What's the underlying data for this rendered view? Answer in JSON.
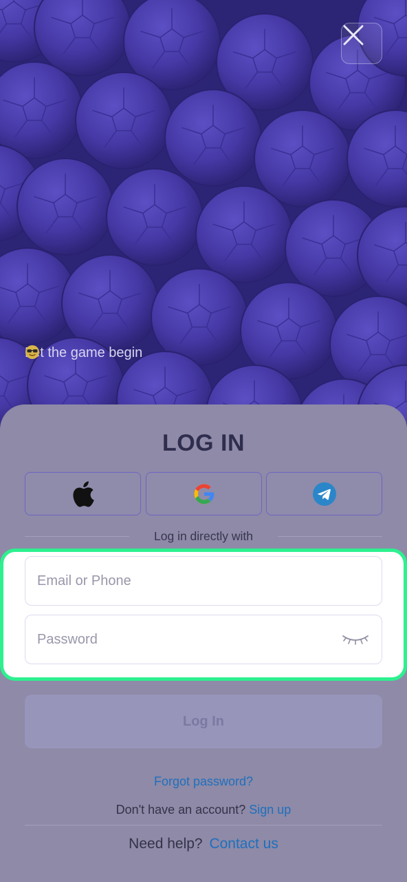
{
  "hero": {
    "tagline": "Let the game begin",
    "tagline_emoji": "sunglasses-emoji"
  },
  "close_icon": "close-icon",
  "login": {
    "title": "LOG IN",
    "social": [
      {
        "name": "apple",
        "icon": "apple-icon"
      },
      {
        "name": "google",
        "icon": "google-icon"
      },
      {
        "name": "telegram",
        "icon": "telegram-icon"
      }
    ],
    "divider_text": "Log in directly with",
    "email_placeholder": "Email or Phone",
    "password_placeholder": "Password",
    "password_toggle_icon": "eye-closed-icon",
    "submit_label": "Log In",
    "forgot_password": "Forgot password?",
    "no_account_text": "Don't have an account?",
    "signup_link": "Sign up",
    "help_text": "Need help?",
    "contact_link": "Contact us"
  },
  "colors": {
    "hero_background": "#2c2576",
    "sheet_overlay": "#8e8aa7",
    "highlight_border": "#2ef08f",
    "link": "#1f6fbd",
    "social_border": "#6c66c2"
  }
}
